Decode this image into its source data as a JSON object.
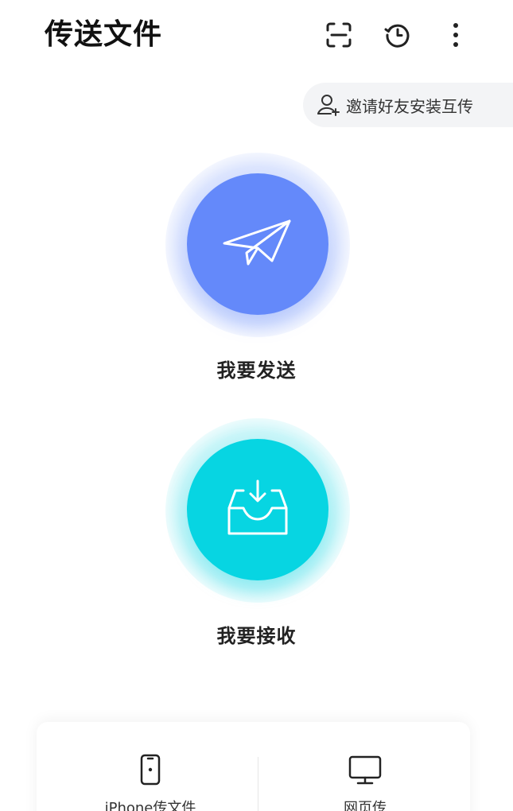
{
  "header": {
    "title": "传送文件",
    "icons": [
      "scan-icon",
      "history-icon",
      "more-vertical-icon"
    ]
  },
  "invite": {
    "label": "邀请好友安装互传",
    "icon": "user-add-icon"
  },
  "send": {
    "label": "我要发送",
    "icon": "paper-plane-icon",
    "color": "#6489fa"
  },
  "receive": {
    "label": "我要接收",
    "icon": "inbox-download-icon",
    "color": "#07d5e2"
  },
  "bottom": {
    "items": [
      {
        "label": "iPhone传文件",
        "icon": "iphone-icon"
      },
      {
        "label": "网页传",
        "icon": "monitor-icon"
      }
    ]
  }
}
